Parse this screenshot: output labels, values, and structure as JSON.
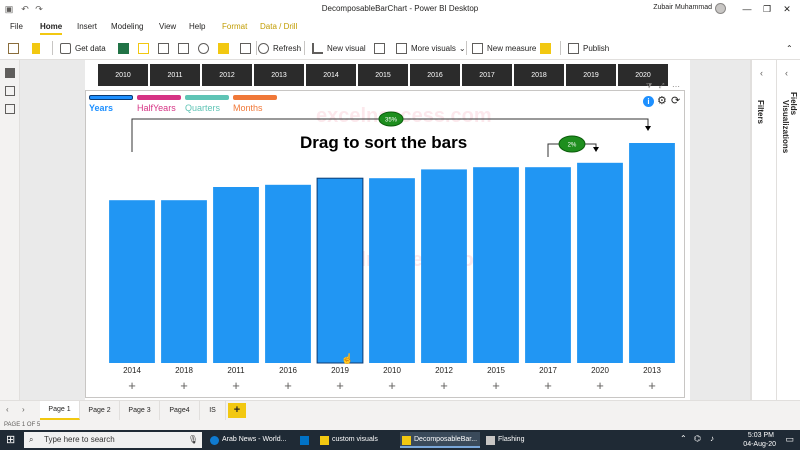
{
  "app": {
    "window_title": "DecomposableBarChart - Power BI Desktop",
    "user_name": "Zubair Muhammad"
  },
  "menu": [
    "File",
    "Home",
    "Insert",
    "Modeling",
    "View",
    "Help",
    "Format",
    "Data / Drill"
  ],
  "ribbon": {
    "get_data": "Get data",
    "refresh": "Refresh",
    "new_visual": "New visual",
    "more_visuals": "More visuals",
    "new_measure": "New measure",
    "publish": "Publish"
  },
  "slicer_years": [
    "2010",
    "2011",
    "2012",
    "2013",
    "2014",
    "2015",
    "2016",
    "2017",
    "2018",
    "2019",
    "2020"
  ],
  "visual": {
    "tabs": [
      {
        "label": "Years",
        "color": "#1e90ff",
        "active": true
      },
      {
        "label": "HalfYears",
        "color": "#d63384"
      },
      {
        "label": "Quarters",
        "color": "#5fc4b5"
      },
      {
        "label": "Months",
        "color": "#f07838"
      }
    ],
    "hint": "Drag to sort the bars",
    "watermark": "excelnaccess.com",
    "badge_main": "35%",
    "badge_small": "2%",
    "expand_symbol": "+"
  },
  "chart_data": {
    "type": "bar",
    "categories": [
      "2014",
      "2018",
      "2011",
      "2016",
      "2019",
      "2010",
      "2012",
      "2015",
      "2017",
      "2020",
      "2013"
    ],
    "values": [
      74,
      74,
      80,
      81,
      84,
      84,
      88,
      89,
      89,
      91,
      100
    ],
    "ylim": [
      0,
      110
    ],
    "bar_color": "#2196f3",
    "grid": false
  },
  "pages": [
    "Page 1",
    "Page 2",
    "Page 3",
    "Page4",
    "IS"
  ],
  "status": "PAGE 1 OF 5",
  "panes": {
    "filters": "Filters",
    "visualizations": "Visualizations",
    "fields": "Fields"
  },
  "taskbar": {
    "search_placeholder": "Type here to search",
    "apps": [
      "Arab News - World...",
      "custom visuals",
      "DecomposableBar...",
      "Flashing"
    ],
    "time": "5:03 PM",
    "date": "04-Aug-20"
  }
}
